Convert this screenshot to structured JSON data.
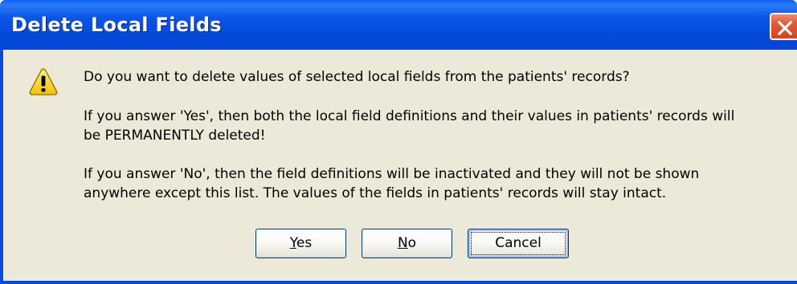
{
  "window": {
    "title": "Delete Local Fields",
    "close_icon": "close-icon"
  },
  "dialog": {
    "icon": "warning-icon",
    "question": "Do you want to delete values of selected local fields from the patients' records?",
    "yes_explanation_line1": "If you answer 'Yes', then both the local field definitions and their values in patients' records will",
    "yes_explanation_line2": "be PERMANENTLY deleted!",
    "no_explanation_line1": "If you answer 'No', then the field definitions will be inactivated and they will not be shown",
    "no_explanation_line2": "anywhere except this list. The values of the fields in patients' records will stay intact."
  },
  "buttons": {
    "yes": {
      "accel": "Y",
      "rest": "es"
    },
    "no": {
      "accel": "N",
      "rest": "o"
    },
    "cancel": {
      "label": "Cancel",
      "focused": true
    }
  },
  "colors": {
    "titlebar": "#0348d8",
    "client_background": "#ece9d8",
    "close_button": "#d8421d",
    "warning_yellow": "#ffd700"
  }
}
